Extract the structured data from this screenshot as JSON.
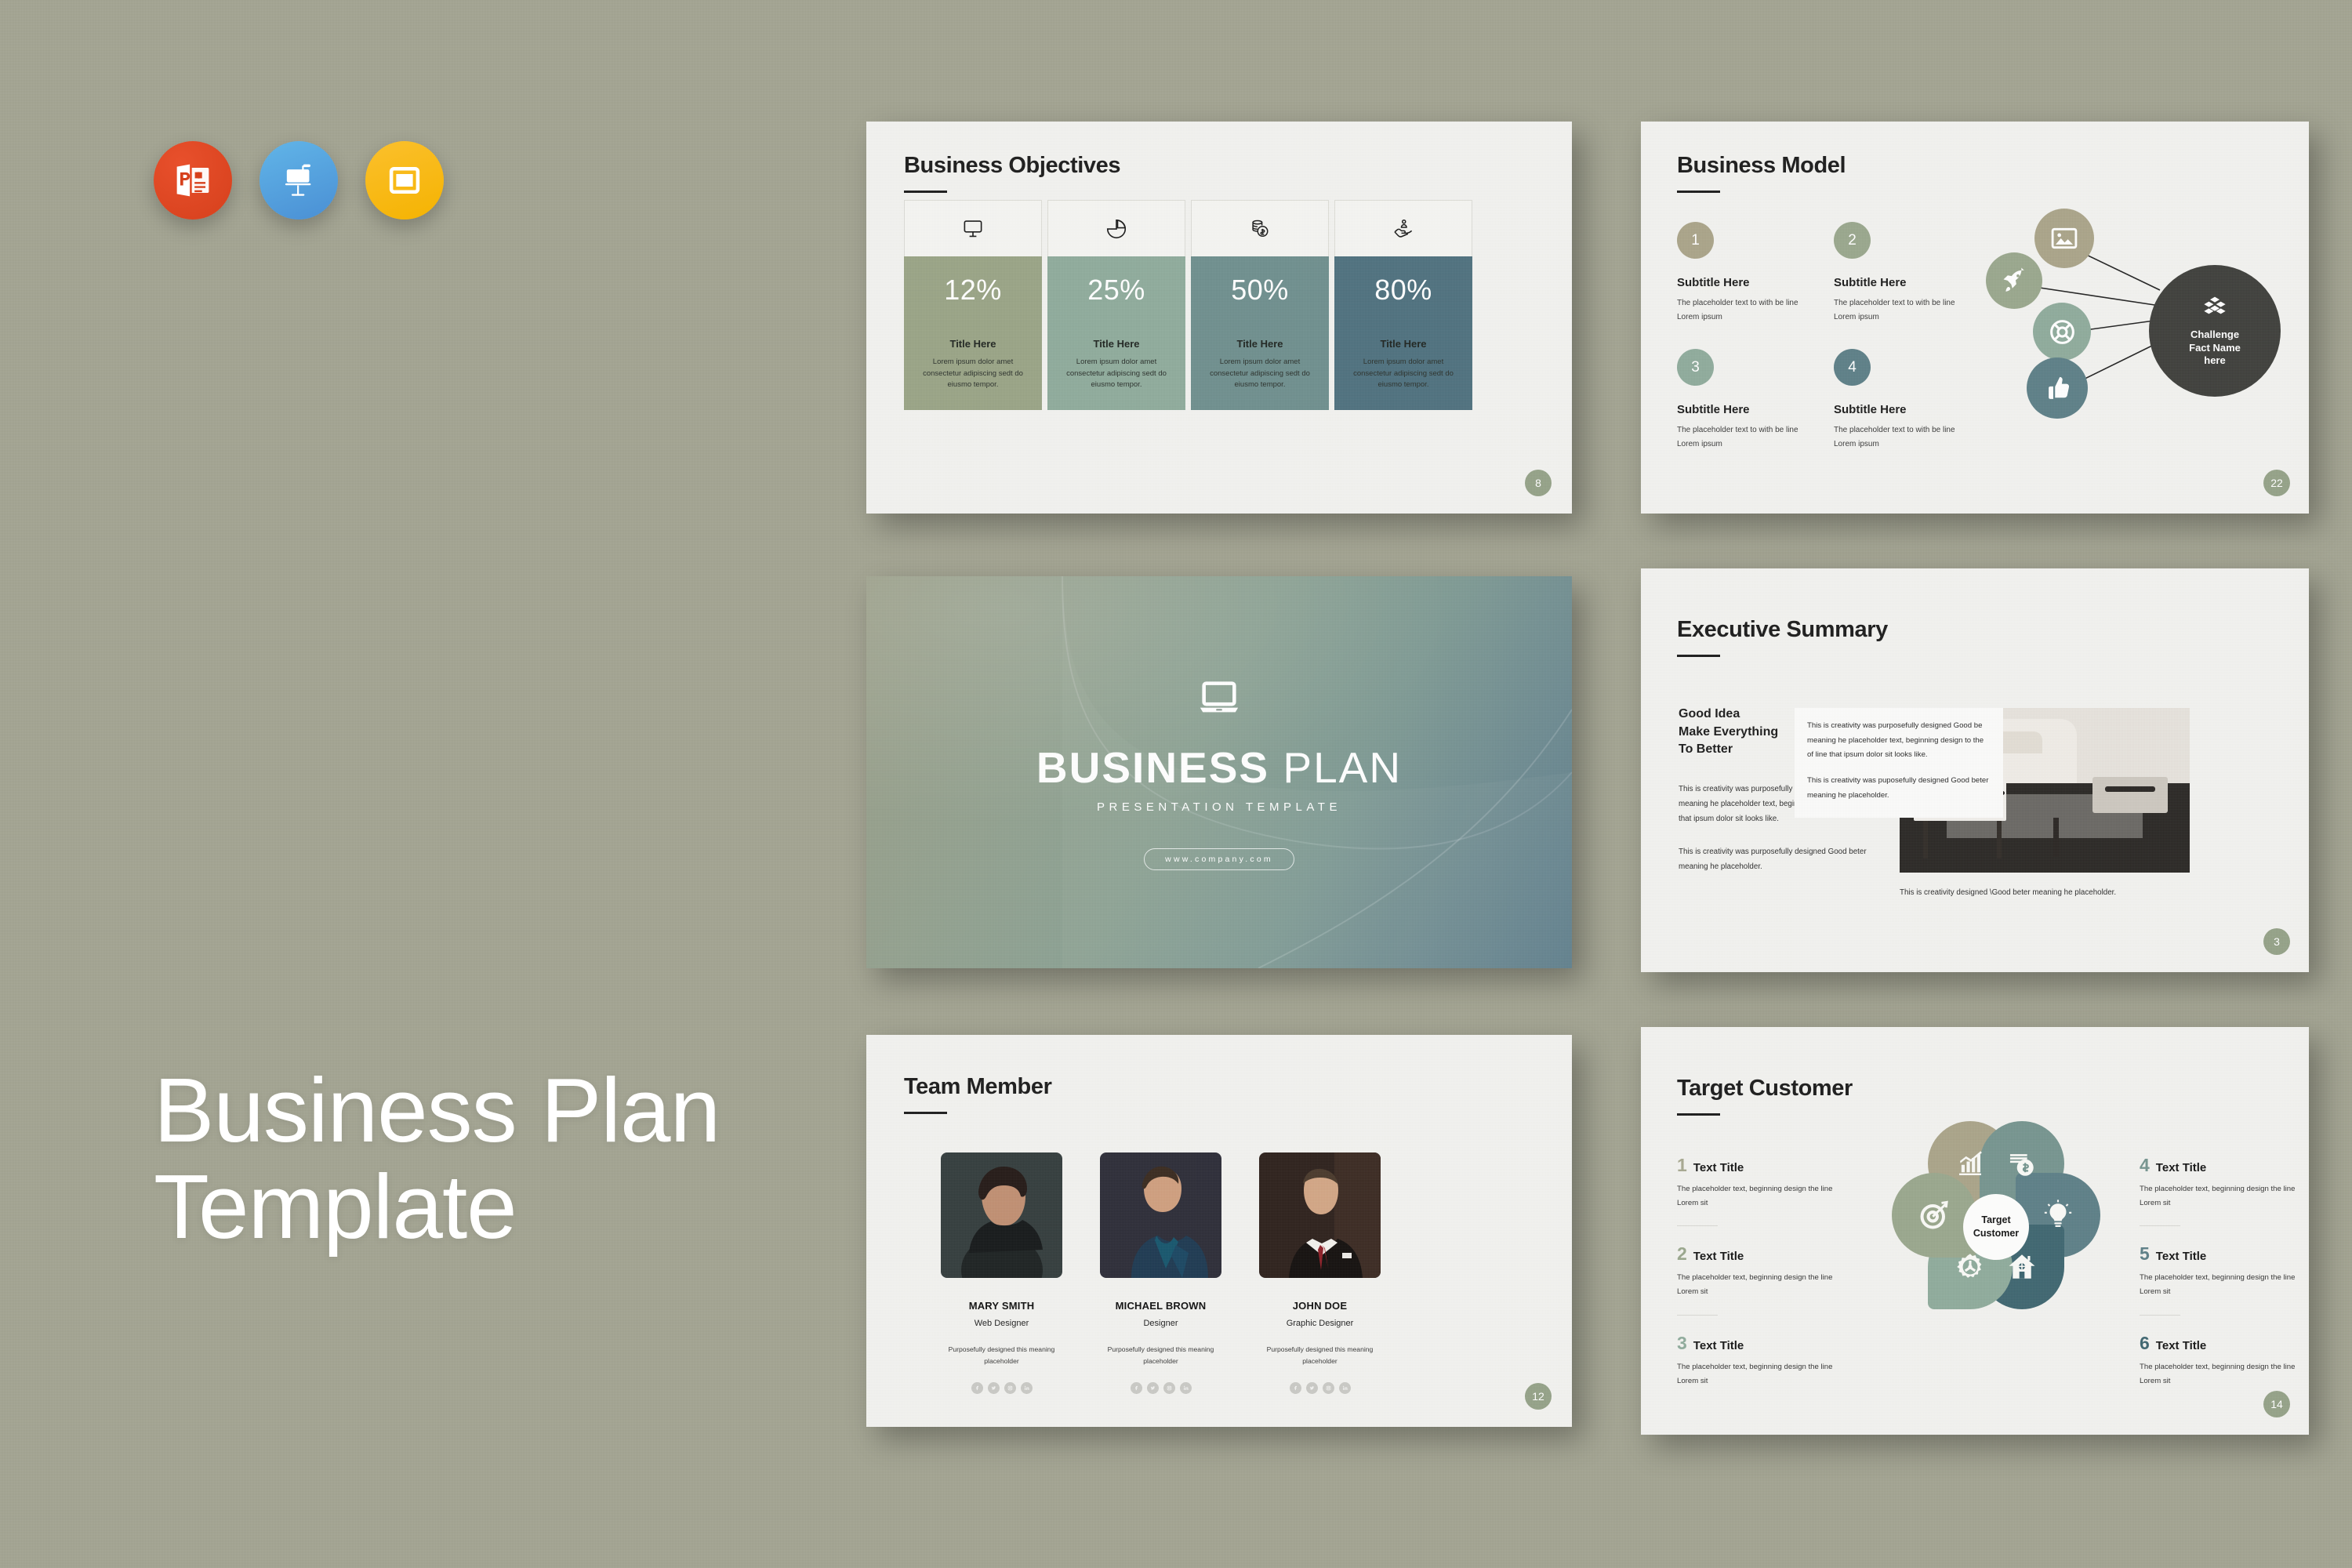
{
  "background_color": "#a3a492",
  "promo": {
    "headline_line1": "Business Plan",
    "headline_line2": "Template",
    "app_icons": [
      {
        "name": "powerpoint-icon",
        "label": "PowerPoint",
        "color": "#d6401c"
      },
      {
        "name": "keynote-icon",
        "label": "Keynote",
        "color": "#4a8fd4"
      },
      {
        "name": "google-slides-icon",
        "label": "Google Slides",
        "color": "#f5b301"
      }
    ]
  },
  "palette": {
    "sage": "#9aa486",
    "sage_light": "#a8ae94",
    "tan": "#aaa489",
    "green_mid": "#8fab9c",
    "teal_mid": "#76958f",
    "teal": "#62868c",
    "teal_dark": "#4b6e75",
    "slate": "#4f717e",
    "charcoal": "#3f403c"
  },
  "slides": {
    "objectives": {
      "title": "Business Objectives",
      "page": "8",
      "cards": [
        {
          "icon": "monitor-icon",
          "percent": "12%",
          "title": "Title Here",
          "desc": "Lorem ipsum dolor amet consectetur adipiscing sedt do eiusmo tempor.",
          "color": "#9aa486"
        },
        {
          "icon": "pie-chart-icon",
          "percent": "25%",
          "title": "Title Here",
          "desc": "Lorem ipsum dolor amet consectetur adipiscing sedt do eiusmo tempor.",
          "color": "#8fab9c"
        },
        {
          "icon": "money-coins-icon",
          "percent": "50%",
          "title": "Title Here",
          "desc": "Lorem ipsum dolor amet consectetur adipiscing sedt do eiusmo tempor.",
          "color": "#6f8f8e"
        },
        {
          "icon": "hand-user-icon",
          "percent": "80%",
          "title": "Title Here",
          "desc": "Lorem ipsum dolor amet consectetur adipiscing sedt do eiusmo tempor.",
          "color": "#4f717e"
        }
      ]
    },
    "model": {
      "title": "Business Model",
      "page": "22",
      "items": [
        {
          "num": "1",
          "subtitle": "Subtitle Here",
          "text": "The placeholder text to with be line Lorem ipsum",
          "color": "#aaa489"
        },
        {
          "num": "2",
          "subtitle": "Subtitle Here",
          "text": "The placeholder text to with be line Lorem ipsum",
          "color": "#9aa78d"
        },
        {
          "num": "3",
          "subtitle": "Subtitle Here",
          "text": "The placeholder text to with be line Lorem ipsum",
          "color": "#8fab9c"
        },
        {
          "num": "4",
          "subtitle": "Subtitle Here",
          "text": "The placeholder text to with be line Lorem ipsum",
          "color": "#5d7f87"
        }
      ],
      "hub_label": "Challenge\nFact Name\nhere",
      "hub_line1": "Challenge",
      "hub_line2": "Fact Name",
      "hub_line3": "here",
      "hub_icon": "blocks-icon",
      "nodes": [
        {
          "icon": "image-icon",
          "color": "#aaa489"
        },
        {
          "icon": "rocket-icon",
          "color": "#9aa78d"
        },
        {
          "icon": "lifebuoy-icon",
          "color": "#8fab9c"
        },
        {
          "icon": "thumbs-up-icon",
          "color": "#5d7f87"
        }
      ]
    },
    "hero": {
      "icon": "laptop-icon",
      "title_bold": "BUSINESS",
      "title_light": "PLAN",
      "subtitle": "PRESENTATION TEMPLATE",
      "url": "www.company.com"
    },
    "executive": {
      "title": "Executive Summary",
      "page": "3",
      "heading_line1": "Good Idea",
      "heading_line2": "Make Everything",
      "heading_line3": "To Better",
      "left_para1": "This is creativity was purposefully  designed Good be meaning he placeholder text, beginning  design to the of line that ipsum dolor sit looks like.",
      "left_para2": "This is creativity was purposefully  designed Good beter meaning he placeholder.",
      "card_para1": "This is creativity was purposefully  designed Good be meaning he placeholder text, beginning  design to the of line that ipsum dolor sit looks like.",
      "card_para2": "This is creativity was puposefully  designed Good beter meaning he placeholder.",
      "caption": "This is creativity designed \\Good beter meaning he placeholder.",
      "image_alt": "interior-living-room-photo"
    },
    "team": {
      "title": "Team Member",
      "page": "12",
      "members": [
        {
          "name": "MARY SMITH",
          "role": "Web Designer",
          "bio": "Purposefully designed this meaning placeholder",
          "photo": "portrait-woman"
        },
        {
          "name": "MICHAEL BROWN",
          "role": "Designer",
          "bio": "Purposefully designed this meaning placeholder",
          "photo": "portrait-man-blue"
        },
        {
          "name": "JOHN DOE",
          "role": "Graphic Designer",
          "bio": "Purposefully designed this meaning placeholder",
          "photo": "portrait-man-suit"
        }
      ],
      "socials": [
        "facebook-icon",
        "twitter-icon",
        "instagram-icon",
        "linkedin-icon"
      ]
    },
    "target": {
      "title": "Target Customer",
      "page": "14",
      "center_line1": "Target",
      "center_line2": "Customer",
      "left_items": [
        {
          "num": "1",
          "title": "Text Title",
          "text": "The placeholder text, beginning design the line Lorem sit",
          "color": "#a7a890"
        },
        {
          "num": "2",
          "title": "Text Title",
          "text": "The placeholder text, beginning design the line Lorem sit",
          "color": "#9aa78d"
        },
        {
          "num": "3",
          "title": "Text Title",
          "text": "The placeholder text, beginning design the line Lorem sit",
          "color": "#8fab9c"
        }
      ],
      "right_items": [
        {
          "num": "4",
          "title": "Text Title",
          "text": "The placeholder text, beginning design the line Lorem sit",
          "color": "#76958f"
        },
        {
          "num": "5",
          "title": "Text Title",
          "text": "The placeholder text, beginning design the line Lorem sit",
          "color": "#5d7f87"
        },
        {
          "num": "6",
          "title": "Text Title",
          "text": "The placeholder text, beginning design the line Lorem sit",
          "color": "#3f6670"
        }
      ],
      "petals": [
        {
          "icon": "bar-chart-icon",
          "color": "#aaa489"
        },
        {
          "icon": "money-stack-icon",
          "color": "#76958f"
        },
        {
          "icon": "lightbulb-icon",
          "color": "#5d7f87"
        },
        {
          "icon": "house-icon",
          "color": "#3f6670"
        },
        {
          "icon": "gear-icon",
          "color": "#8fab9c"
        },
        {
          "icon": "target-icon",
          "color": "#9aa78d"
        }
      ]
    }
  }
}
